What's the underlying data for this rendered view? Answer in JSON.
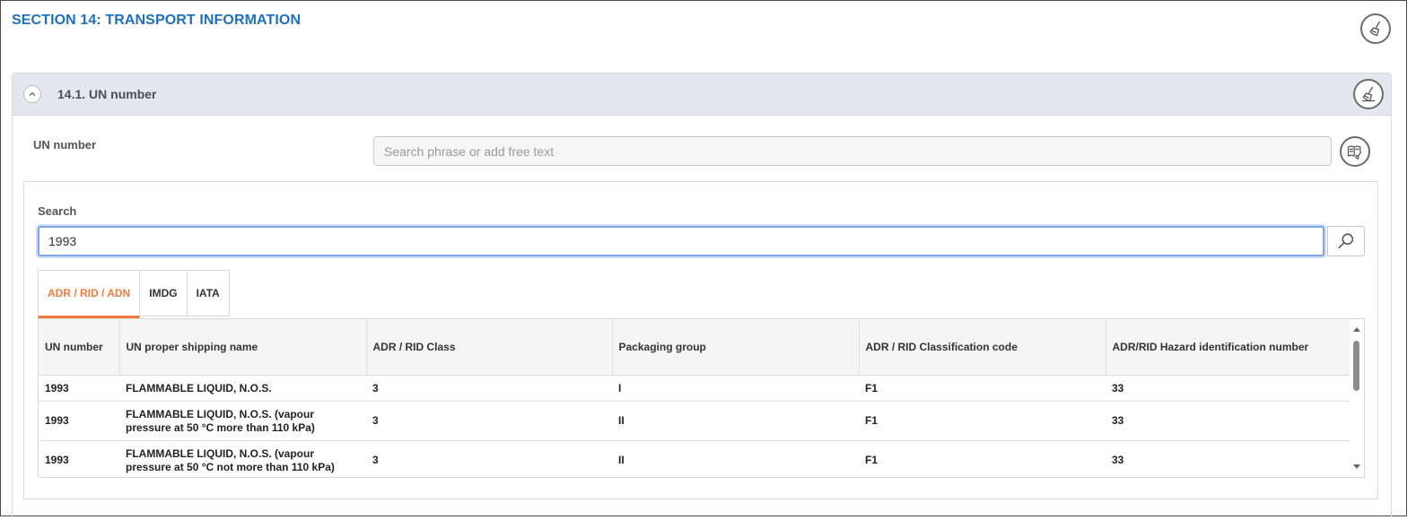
{
  "section": {
    "title": "SECTION 14: TRANSPORT INFORMATION",
    "clear_icon": "broom-icon"
  },
  "accordion": {
    "title": "14.1. UN number",
    "toggle_icon": "chevron-up-icon",
    "clear_icon": "broom-icon"
  },
  "un_field": {
    "label": "UN number",
    "value": "",
    "placeholder": "Search phrase or add free text",
    "phrase_icon": "phrase-book-icon"
  },
  "search": {
    "label": "Search",
    "value": "1993",
    "button_icon": "search-icon"
  },
  "tabs": [
    {
      "label": "ADR / RID / ADN",
      "active": true
    },
    {
      "label": "IMDG",
      "active": false
    },
    {
      "label": "IATA",
      "active": false
    }
  ],
  "table": {
    "columns": [
      "UN number",
      "UN proper shipping name",
      "ADR / RID Class",
      "Packaging group",
      "ADR / RID Classification code",
      "ADR/RID Hazard identification number"
    ],
    "rows": [
      [
        "1993",
        "FLAMMABLE LIQUID, N.O.S.",
        "3",
        "I",
        "F1",
        "33"
      ],
      [
        "1993",
        "FLAMMABLE LIQUID, N.O.S. (vapour pressure at 50 °C more than 110 kPa)",
        "3",
        "II",
        "F1",
        "33"
      ],
      [
        "1993",
        "FLAMMABLE LIQUID, N.O.S. (vapour pressure at 50 °C not more than 110 kPa)",
        "3",
        "II",
        "F1",
        "33"
      ]
    ]
  },
  "colors": {
    "section_title": "#1f6fbf",
    "active_tab": "#f07b3f",
    "accordion_header_bg": "#e3e8ef",
    "focus_border": "#7fa7e6"
  }
}
